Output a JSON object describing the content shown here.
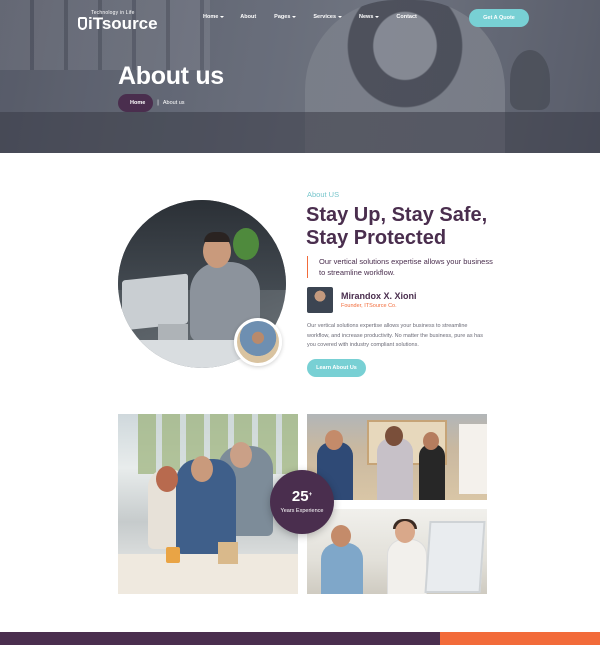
{
  "header": {
    "logo_tagline": "Technology in Life",
    "logo_name": "iTsource",
    "nav": [
      {
        "label": "Home",
        "dropdown": true
      },
      {
        "label": "About",
        "dropdown": false
      },
      {
        "label": "Pages",
        "dropdown": true
      },
      {
        "label": "Services",
        "dropdown": true
      },
      {
        "label": "News",
        "dropdown": true
      },
      {
        "label": "Contact",
        "dropdown": false
      }
    ],
    "cta_label": "Get A Quote"
  },
  "hero": {
    "title": "About us",
    "breadcrumb": {
      "home": "Home",
      "separator": "|",
      "current": "About us"
    }
  },
  "about": {
    "eyebrow": "About US",
    "heading_line1": "Stay Up, Stay Safe,",
    "heading_line2": "Stay Protected",
    "quote": "Our vertical solutions expertise allows your business to streamline workflow.",
    "founder_name": "Mirandox X. Xioni",
    "founder_role": "Founder, ITSource Co.",
    "paragraph": "Our vertical solutions expertise allows your business to streamline workflow, and increase productivity. No matter the business, pure as has you covered with industry compliant solutions.",
    "button_label": "Learn About Us"
  },
  "experience": {
    "number": "25",
    "suffix": "+",
    "label": "Years Experience"
  },
  "colors": {
    "primary": "#4a2e4e",
    "accent_teal": "#78d0d4",
    "accent_orange": "#f26b3a"
  }
}
